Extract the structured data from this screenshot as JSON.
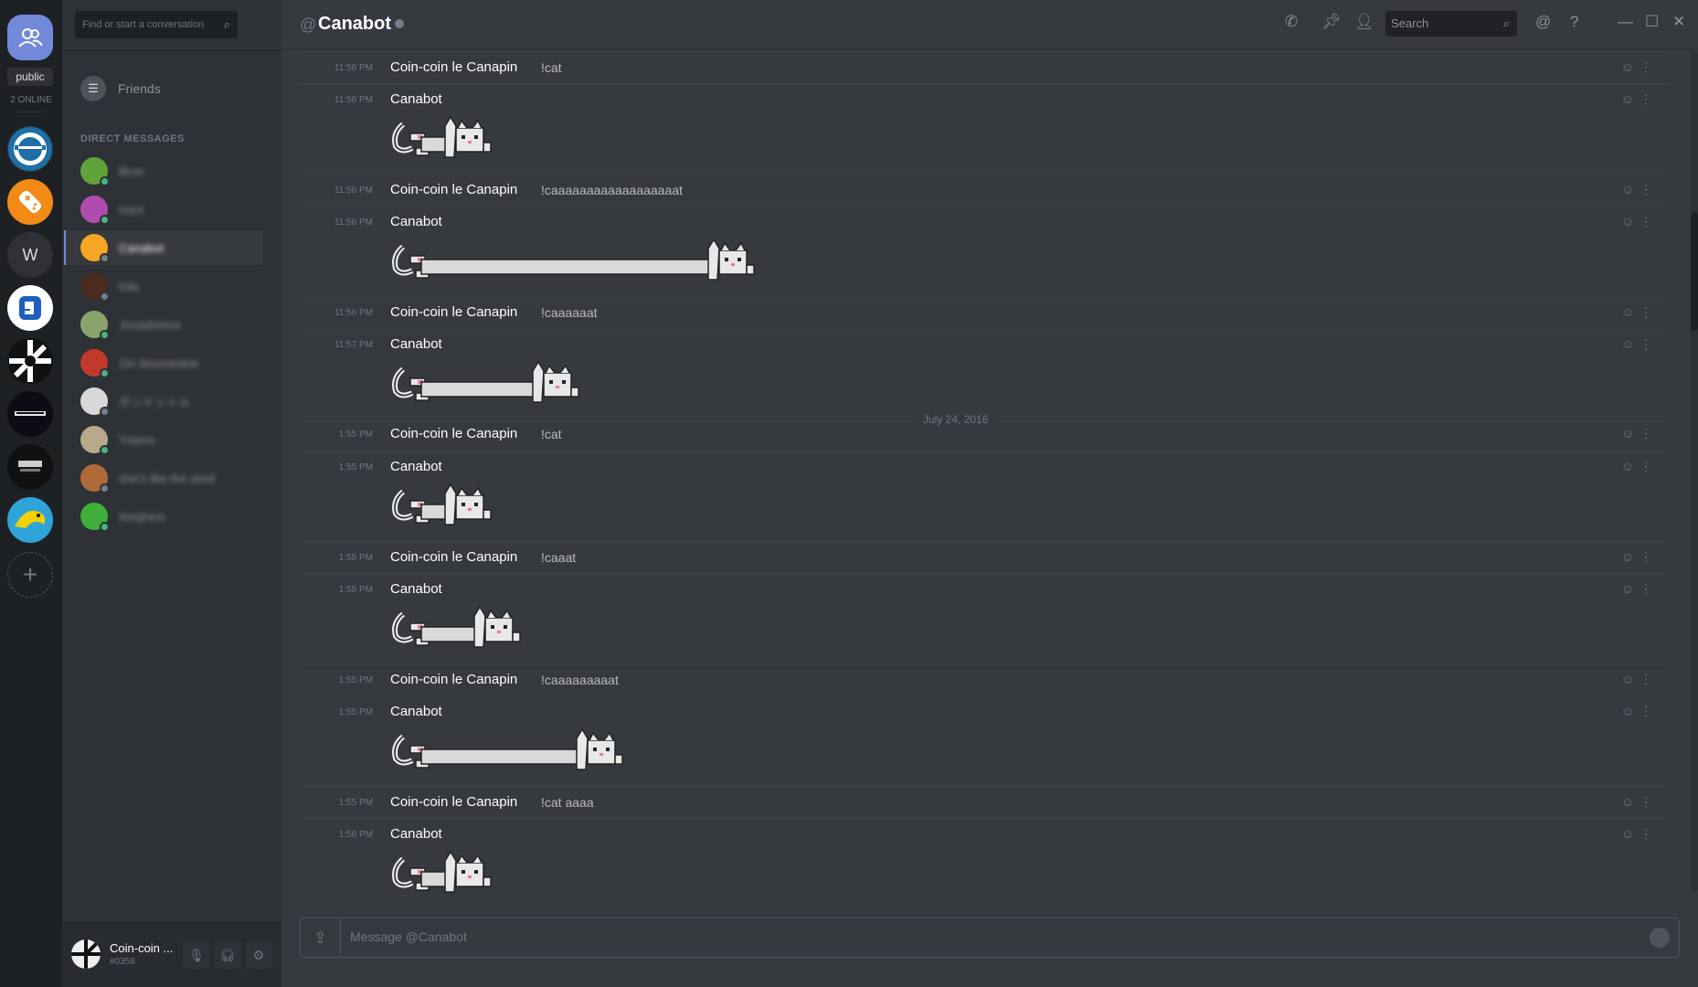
{
  "guild_bar": {
    "public_label": "public",
    "online_label": "2 ONLINE",
    "w_label": "W",
    "add_label": "+"
  },
  "sidebar": {
    "search_placeholder": "Find or start a conversation",
    "friends_label": "Friends",
    "dm_header": "DIRECT MESSAGES",
    "dms": [
      {
        "name": "Brun",
        "online": true,
        "color": "#5fa33a"
      },
      {
        "name": "mice",
        "online": true,
        "color": "#b04cb0"
      },
      {
        "name": "Canabot",
        "online": false,
        "color": "#f5a623",
        "active": true
      },
      {
        "name": "Kila",
        "online": false,
        "color": "#4a2c1e"
      },
      {
        "name": "JoviaAnima",
        "online": true,
        "color": "#8aa36d"
      },
      {
        "name": "Zin doosoeskie",
        "online": true,
        "color": "#c0392b"
      },
      {
        "name": "ボンドットル",
        "online": false,
        "color": "#d8d8d8"
      },
      {
        "name": "Triamo",
        "online": true,
        "color": "#b8a98a"
      },
      {
        "name": "she's like the wind",
        "online": false,
        "color": "#b06a3a"
      },
      {
        "name": "Anejheni",
        "online": true,
        "color": "#3fae3a"
      }
    ],
    "user": {
      "name": "Coin-coin ...",
      "tag": "#0358"
    }
  },
  "chat": {
    "at_symbol": "@",
    "title": "Canabot",
    "search_placeholder": "Search",
    "date_divider": "July 24, 2016",
    "composer_placeholder": "Message @Canabot",
    "messages": [
      {
        "time": "11:56 PM",
        "author": "Coin-coin le Canapin",
        "content": "!cat"
      },
      {
        "time": "11:56 PM",
        "author": "Canabot",
        "cat_length": 0
      },
      {
        "time": "11:56 PM",
        "author": "Coin-coin le Canapin",
        "content": "!caaaaaaaaaaaaaaaaaat"
      },
      {
        "time": "11:56 PM",
        "author": "Canabot",
        "cat_length": 18
      },
      {
        "time": "11:56 PM",
        "author": "Coin-coin le Canapin",
        "content": "!caaaaaat"
      },
      {
        "time": "11:57 PM",
        "author": "Canabot",
        "cat_length": 6
      },
      {
        "time": "1:55 PM",
        "author": "Coin-coin le Canapin",
        "content": "!cat"
      },
      {
        "time": "1:55 PM",
        "author": "Canabot",
        "cat_length": 0
      },
      {
        "time": "1:55 PM",
        "author": "Coin-coin le Canapin",
        "content": "!caaat"
      },
      {
        "time": "1:55 PM",
        "author": "Canabot",
        "cat_length": 2
      },
      {
        "time": "1:55 PM",
        "author": "Coin-coin le Canapin",
        "content": "!caaaaaaaaat"
      },
      {
        "time": "1:55 PM",
        "author": "Canabot",
        "cat_length": 9
      },
      {
        "time": "1:55 PM",
        "author": "Coin-coin le Canapin",
        "content": "!cat aaaa"
      },
      {
        "time": "1:56 PM",
        "author": "Canabot",
        "cat_length": 0
      }
    ]
  },
  "colors": {
    "accent": "#7289da",
    "online": "#43b581",
    "offline": "#747f8d"
  },
  "icons": {
    "topbar": [
      "phone-icon",
      "pin-icon",
      "add-friend-icon",
      "mention-icon",
      "help-icon",
      "minimize-icon",
      "maximize-icon",
      "close-icon"
    ]
  }
}
